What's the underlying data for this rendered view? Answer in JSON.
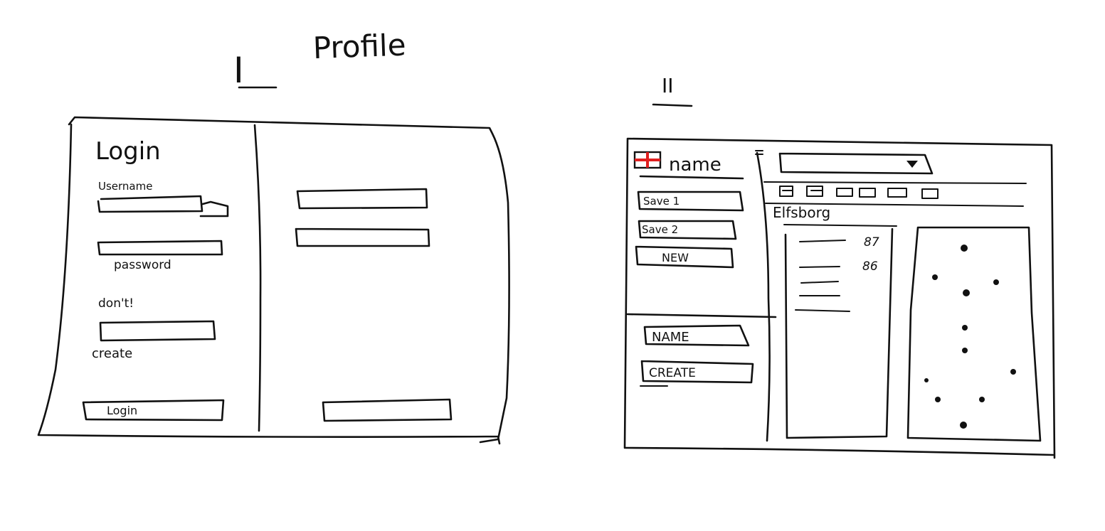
{
  "title": "Profile",
  "mockup_1": {
    "label": "I",
    "heading": "Login",
    "username_label": "Username",
    "password_label": "password",
    "dont_label": "don't!",
    "create_label": "create",
    "login_button": "Login"
  },
  "mockup_2": {
    "label": "II",
    "flag_color": "#e02020",
    "name_label": "name",
    "save1_button": "Save 1",
    "save2_button": "Save 2",
    "new_button": "NEW",
    "name_field": "NAME",
    "create_button": "CREATE",
    "leaderboard_label": "Elfsborg",
    "score_1": "87",
    "score_2": "86"
  }
}
